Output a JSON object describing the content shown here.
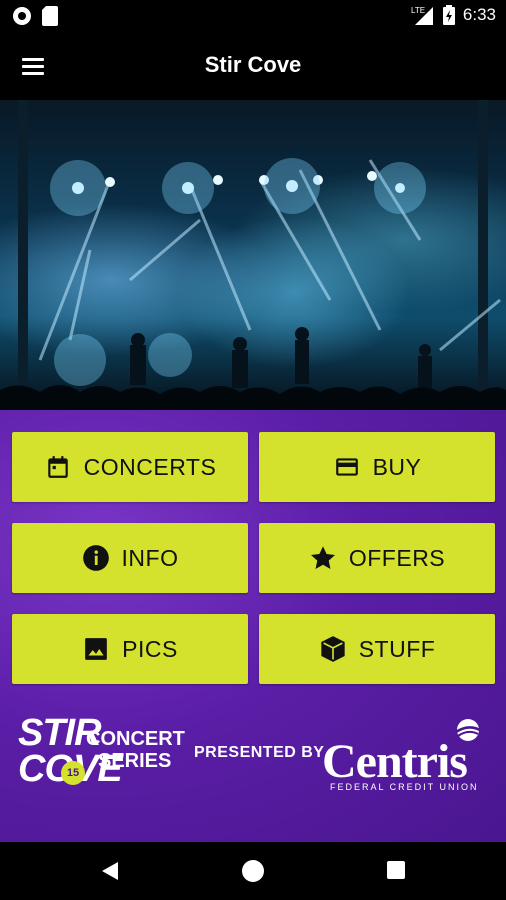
{
  "status_bar": {
    "time": "6:33",
    "icons": [
      "circle-notification-icon",
      "sd-card-icon",
      "lte-signal-icon",
      "battery-icon"
    ]
  },
  "app_bar": {
    "title": "Stir Cove",
    "menu_icon": "hamburger-menu-icon"
  },
  "tiles": [
    {
      "label": "CONCERTS",
      "icon": "calendar-icon"
    },
    {
      "label": "BUY",
      "icon": "credit-card-icon"
    },
    {
      "label": "INFO",
      "icon": "info-icon"
    },
    {
      "label": "OFFERS",
      "icon": "star-icon"
    },
    {
      "label": "PICS",
      "icon": "image-icon"
    },
    {
      "label": "STUFF",
      "icon": "box-icon"
    }
  ],
  "footer": {
    "brand_stir": "STIR",
    "brand_cove": "COVE",
    "brand_concert": "CONCERT",
    "brand_series": "SERIES",
    "brand_badge": "15",
    "presented_by": "PRESENTED BY",
    "sponsor_name": "Centris",
    "sponsor_sub": "FEDERAL CREDIT UNION"
  },
  "colors": {
    "tile": "#d4e22e",
    "purple": "#5b1ea7",
    "bar": "#000000"
  }
}
